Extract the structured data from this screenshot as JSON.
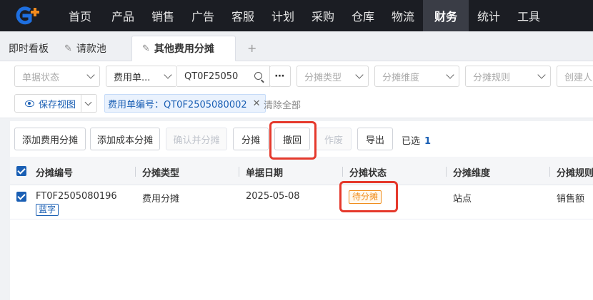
{
  "nav": {
    "items": [
      "首页",
      "产品",
      "销售",
      "广告",
      "客服",
      "计划",
      "采购",
      "仓库",
      "物流",
      "财务",
      "统计",
      "工具"
    ],
    "active_index": 9
  },
  "tabs": {
    "items": [
      {
        "label": "即时看板",
        "pinned": false
      },
      {
        "label": "请款池",
        "pinned": true
      },
      {
        "label": "其他费用分摊",
        "pinned": true,
        "active": true
      }
    ]
  },
  "filters": {
    "status_placeholder": "单据状态",
    "doc_type": "费用单...",
    "search_value": "QT0F25050",
    "alloc_type_placeholder": "分摊类型",
    "alloc_dim_placeholder": "分摊维度",
    "alloc_rule_placeholder": "分摊规则",
    "creator_placeholder": "创建人",
    "save_view": "保存视图",
    "active_tag": "费用单编号：QT0F2505080002",
    "clear_all": "清除全部"
  },
  "actions": {
    "add_expense": "添加费用分摊",
    "add_cost": "添加成本分摊",
    "confirm_allocate": "确认并分摊",
    "allocate": "分摊",
    "withdraw": "撤回",
    "void": "作废",
    "export": "导出",
    "selected_label": "已选",
    "selected_count": "1"
  },
  "table": {
    "headers": [
      "分摊编号",
      "分摊类型",
      "单据日期",
      "分摊状态",
      "分摊维度",
      "分摊规则"
    ],
    "rows": [
      {
        "id": "FT0F2505080196",
        "tag": "蓝字",
        "type": "费用分摊",
        "date": "2025-05-08",
        "status": "待分摊",
        "dimension": "站点",
        "rule": "销售额"
      }
    ]
  },
  "colors": {
    "accent": "#1a5fb4",
    "highlight": "#e5392c",
    "pending": "#f08c1a"
  }
}
